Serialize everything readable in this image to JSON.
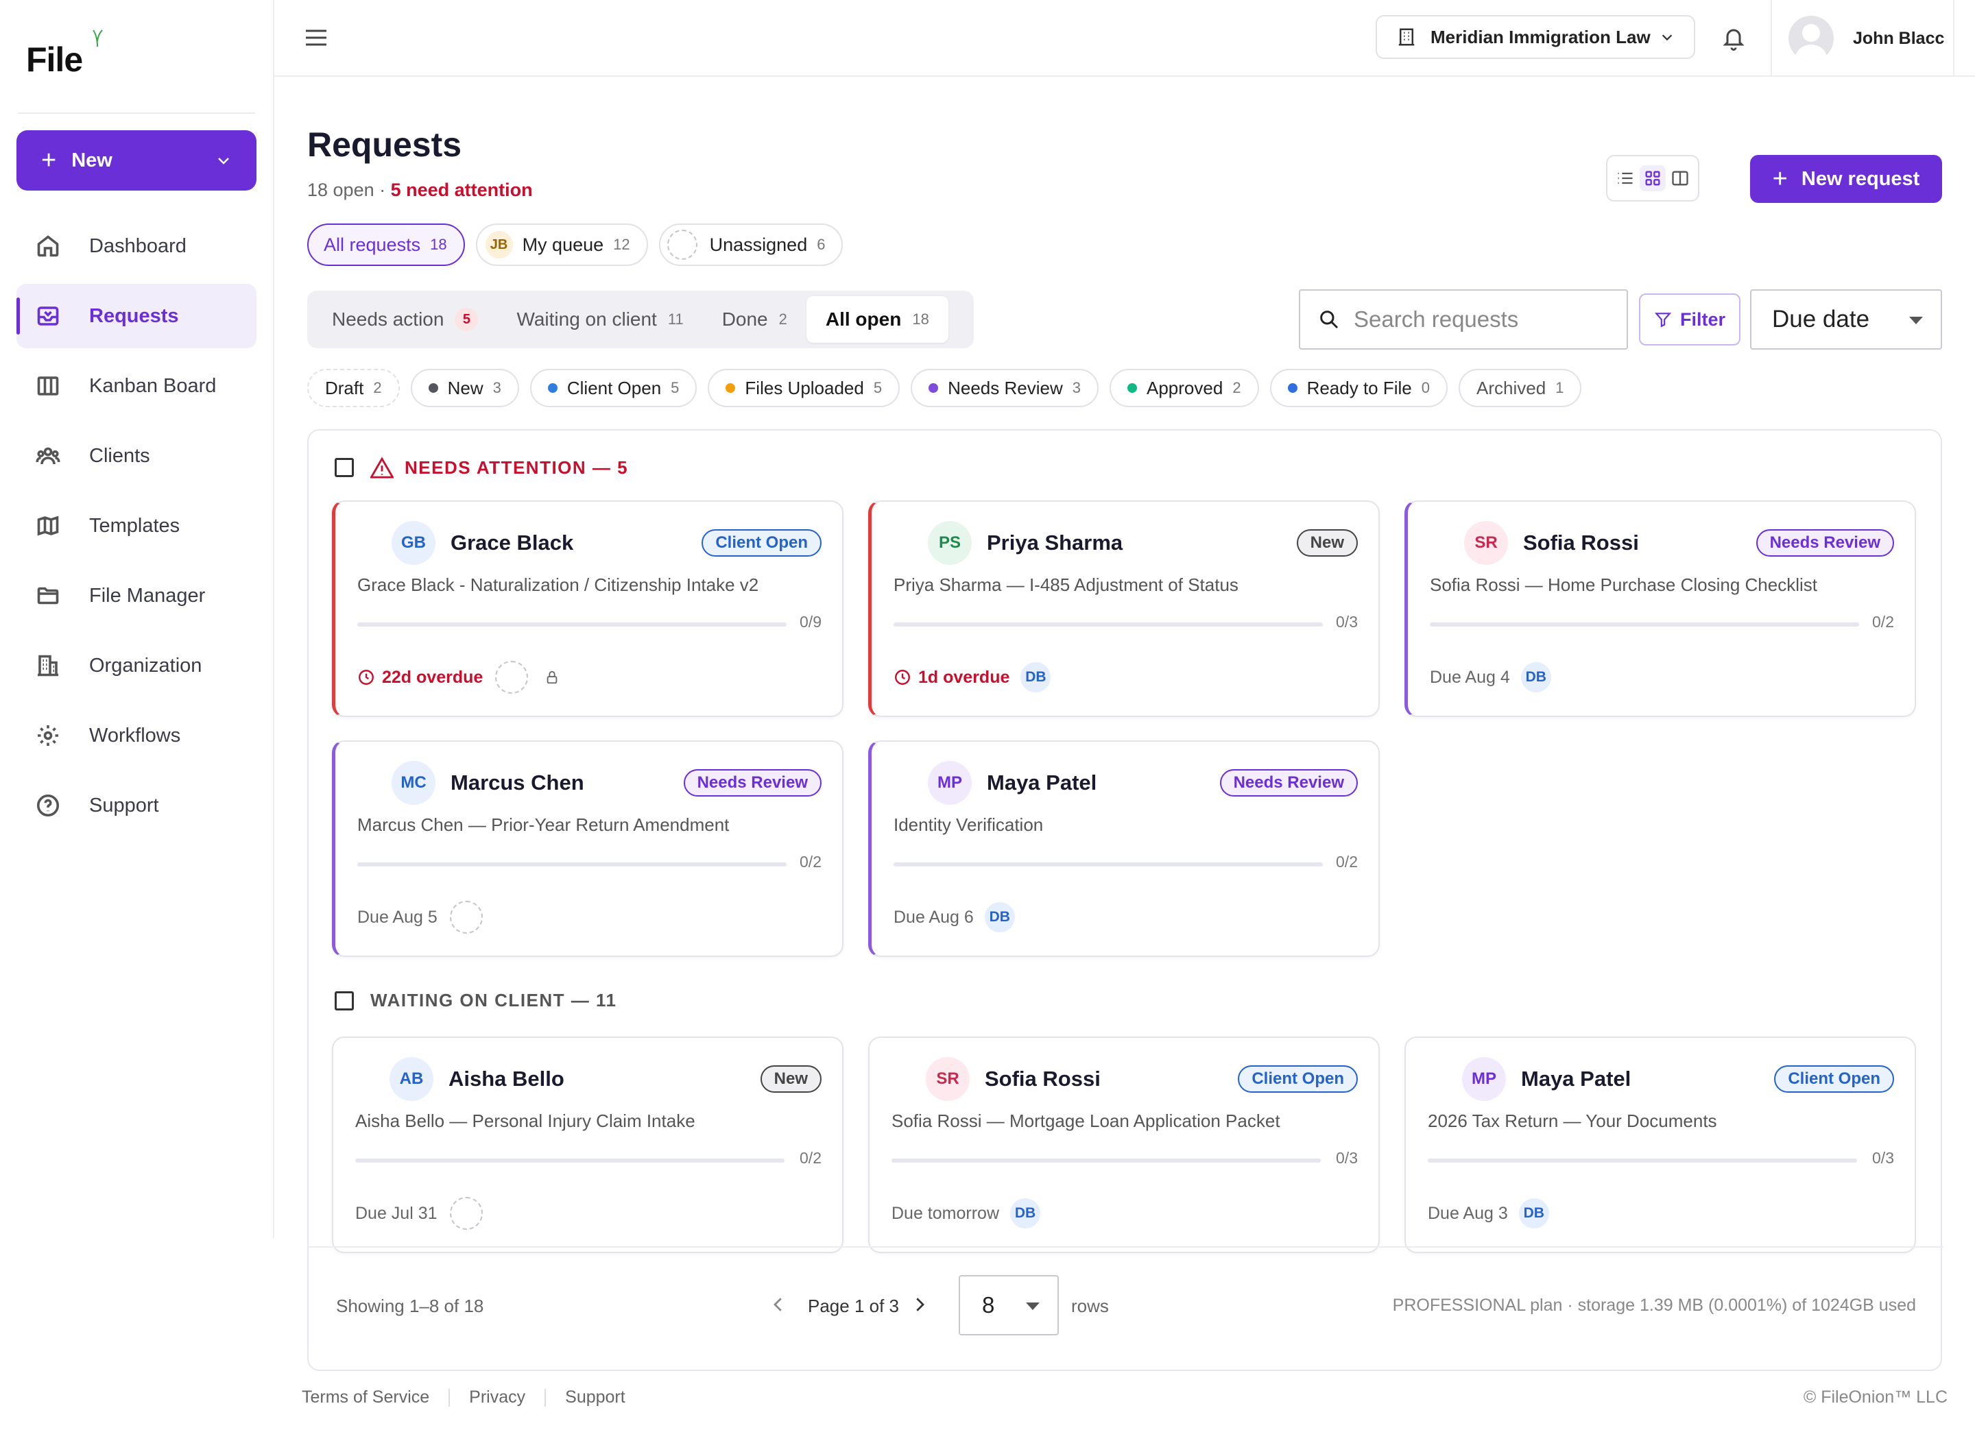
{
  "app": {
    "logo": "File"
  },
  "sidebar": {
    "new_label": "New",
    "items": [
      {
        "label": "Dashboard",
        "icon": "home-icon"
      },
      {
        "label": "Requests",
        "icon": "inbox-icon",
        "active": true
      },
      {
        "label": "Kanban Board",
        "icon": "kanban-icon"
      },
      {
        "label": "Clients",
        "icon": "users-icon"
      },
      {
        "label": "Templates",
        "icon": "map-icon"
      },
      {
        "label": "File Manager",
        "icon": "folder-icon"
      },
      {
        "label": "Organization",
        "icon": "building-icon"
      },
      {
        "label": "Workflows",
        "icon": "gear-icon"
      },
      {
        "label": "Support",
        "icon": "help-icon"
      }
    ]
  },
  "topbar": {
    "org": "Meridian Immigration Law",
    "user": "John Blacc"
  },
  "page": {
    "title": "Requests",
    "open_text": "18 open · ",
    "attention_text": "5 need attention",
    "new_request": "New request"
  },
  "queue": [
    {
      "label": "All requests",
      "count": "18"
    },
    {
      "label": "My queue",
      "count": "12",
      "initials": "JB"
    },
    {
      "label": "Unassigned",
      "count": "6"
    }
  ],
  "tabs": [
    {
      "label": "Needs action",
      "count": "5"
    },
    {
      "label": "Waiting on client",
      "count": "11"
    },
    {
      "label": "Done",
      "count": "2"
    },
    {
      "label": "All open",
      "count": "18"
    }
  ],
  "search": {
    "placeholder": "Search requests"
  },
  "filter_label": "Filter",
  "sort_value": "Due date",
  "statuses": [
    {
      "label": "Draft",
      "count": "2",
      "color": ""
    },
    {
      "label": "New",
      "count": "3",
      "color": "#555560"
    },
    {
      "label": "Client Open",
      "count": "5",
      "color": "#2f7de1"
    },
    {
      "label": "Files Uploaded",
      "count": "5",
      "color": "#f59e0b"
    },
    {
      "label": "Needs Review",
      "count": "3",
      "color": "#7c4ddb"
    },
    {
      "label": "Approved",
      "count": "2",
      "color": "#10b981"
    },
    {
      "label": "Ready to File",
      "count": "0",
      "color": "#2f6fe0"
    },
    {
      "label": "Archived",
      "count": "1",
      "color": ""
    }
  ],
  "sections": {
    "attention": "NEEDS ATTENTION — 5",
    "waiting": "WAITING ON CLIENT — 11"
  },
  "cards": [
    {
      "initials": "GB",
      "name": "Grace Black",
      "badge": "Client Open",
      "desc": "Grace Black - Naturalization / Citizenship Intake v2",
      "progress": "0/9",
      "done": 0,
      "total": 9,
      "due": "22d overdue",
      "overdue": true,
      "assignee": ""
    },
    {
      "initials": "PS",
      "name": "Priya Sharma",
      "badge": "New",
      "desc": "Priya Sharma — I-485 Adjustment of Status",
      "progress": "0/3",
      "done": 0,
      "total": 3,
      "due": "1d overdue",
      "overdue": true,
      "assignee": "DB"
    },
    {
      "initials": "SR",
      "name": "Sofia Rossi",
      "badge": "Needs Review",
      "desc": "Sofia Rossi — Home Purchase Closing Checklist",
      "progress": "0/2",
      "done": 0,
      "total": 2,
      "due": "Due Aug 4",
      "overdue": false,
      "assignee": "DB"
    },
    {
      "initials": "MC",
      "name": "Marcus Chen",
      "badge": "Needs Review",
      "desc": "Marcus Chen — Prior-Year Return Amendment",
      "progress": "0/2",
      "done": 0,
      "total": 2,
      "due": "Due Aug 5",
      "overdue": false,
      "assignee": ""
    },
    {
      "initials": "MP",
      "name": "Maya Patel",
      "badge": "Needs Review",
      "desc": "Identity Verification",
      "progress": "0/2",
      "done": 0,
      "total": 2,
      "due": "Due Aug 6",
      "overdue": false,
      "assignee": "DB"
    },
    {
      "initials": "AB",
      "name": "Aisha Bello",
      "badge": "New",
      "desc": "Aisha Bello — Personal Injury Claim Intake",
      "progress": "0/2",
      "done": 0,
      "total": 2,
      "due": "Due Jul 31",
      "overdue": false,
      "assignee": ""
    },
    {
      "initials": "SR",
      "name": "Sofia Rossi",
      "badge": "Client Open",
      "desc": "Sofia Rossi — Mortgage Loan Application Packet",
      "progress": "0/3",
      "done": 0,
      "total": 3,
      "due": "Due tomorrow",
      "overdue": false,
      "assignee": "DB"
    },
    {
      "initials": "MP",
      "name": "Maya Patel",
      "badge": "Client Open",
      "desc": "2026 Tax Return — Your Documents",
      "progress": "0/3",
      "done": 0,
      "total": 3,
      "due": "Due Aug 3",
      "overdue": false,
      "assignee": "DB"
    }
  ],
  "pager": {
    "showing": "Showing 1–8 of 18",
    "page": "Page 1 of 3",
    "rows": "8",
    "rows_label": "rows",
    "plan": "PROFESSIONAL plan · storage 1.39 MB (0.0001%) of 1024GB used"
  },
  "footer": {
    "links": [
      "Terms of Service",
      "Privacy",
      "Support"
    ],
    "copyright": "© FileOnion™ LLC"
  }
}
